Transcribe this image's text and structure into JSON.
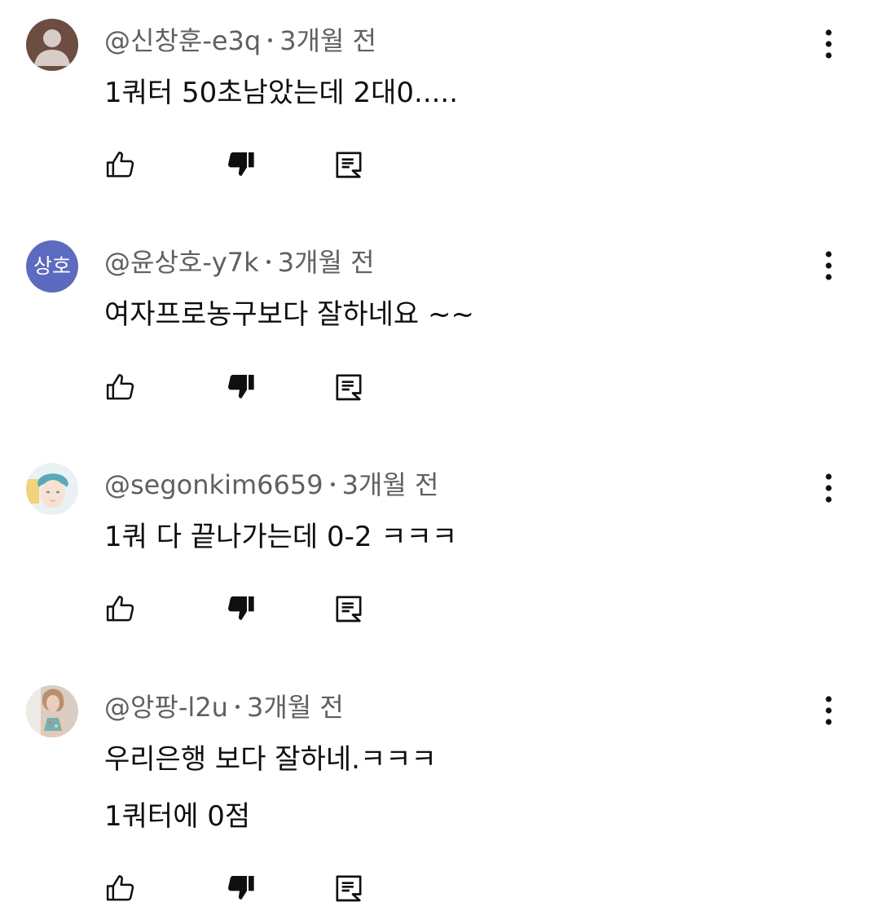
{
  "comments": [
    {
      "author": "@신창훈-e3q",
      "time": "3개월 전",
      "lines": [
        "1쿼터 50초남았는데 2대0....."
      ],
      "avatar": {
        "type": "default",
        "bg": "#6d4c41"
      },
      "icons": {
        "like": "thumbs-up-icon",
        "dislike": "thumbs-down-filled-icon",
        "reply": "reply-icon",
        "more": "more-vert-icon"
      }
    },
    {
      "author": "@윤상호-y7k",
      "time": "3개월 전",
      "lines": [
        "여자프로농구보다 잘하네요 ~~"
      ],
      "avatar": {
        "type": "initials",
        "initials": "상호",
        "bg": "#5c6bc0"
      },
      "icons": {
        "like": "thumbs-up-icon",
        "dislike": "thumbs-down-filled-icon",
        "reply": "reply-icon",
        "more": "more-vert-icon"
      }
    },
    {
      "author": "@segonkim6659",
      "time": "3개월 전",
      "lines": [
        "1쿼 다 끝나가는데 0-2 ㅋㅋㅋ"
      ],
      "avatar": {
        "type": "photo",
        "bg": "#d9e7ea"
      },
      "icons": {
        "like": "thumbs-up-icon",
        "dislike": "thumbs-down-filled-icon",
        "reply": "reply-icon",
        "more": "more-vert-icon"
      }
    },
    {
      "author": "@앙팡-l2u",
      "time": "3개월 전",
      "lines": [
        "우리은행 보다 잘하네.ㅋㅋㅋ",
        "1쿼터에 0점"
      ],
      "avatar": {
        "type": "photo",
        "bg": "#cfc4ba"
      },
      "icons": {
        "like": "thumbs-up-icon",
        "dislike": "thumbs-down-filled-icon",
        "reply": "reply-icon",
        "more": "more-vert-icon"
      }
    }
  ],
  "colors": {
    "meta_text": "#606060",
    "body_text": "#0f0f0f",
    "icon": "#0f0f0f"
  }
}
